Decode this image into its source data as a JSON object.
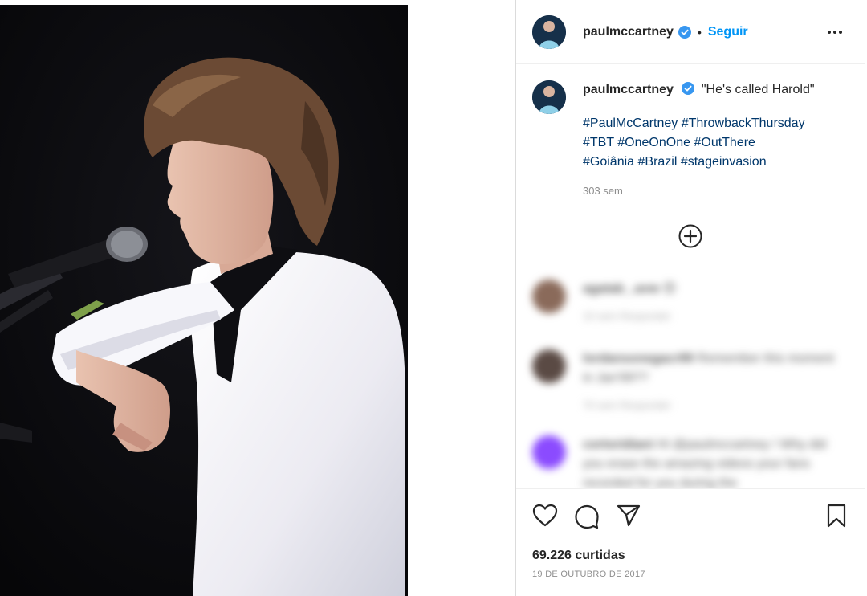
{
  "post": {
    "username": "paulmccartney",
    "follow_label": "Seguir",
    "separator": "•",
    "caption": "\"He's called Harold\"",
    "hashtags": [
      "#PaulMcCartney",
      "#ThrowbackThursday",
      "#TBT",
      "#OneOnOne",
      "#OutThere",
      "#Goiânia",
      "#Brazil",
      "#stageinvasion"
    ],
    "time_ago": "303 sem",
    "likes": "69.226 curtidas",
    "date": "19 DE OUTUBRO DE 2017"
  },
  "comments": [
    {
      "user": "agatab_.avw",
      "text": "😍",
      "meta": "10 sem    Responder",
      "avatar_color": "#8a6a5a"
    },
    {
      "user": "lordansonegacr99",
      "text": "Remember this moment in Jan'99??",
      "meta": "70 sem    Responder",
      "avatar_color": "#5a4a44"
    },
    {
      "user": "cortoridiani",
      "text": "Hi @paulmccartney ! Why did you erase the amazing videos your fans recorded for you during the",
      "meta": "",
      "avatar_color": "#8b4bff"
    }
  ],
  "icons": {
    "verified": "verified-badge-icon",
    "more": "more-options-icon",
    "load_more": "plus-circle-icon",
    "like": "heart-icon",
    "comment": "comment-icon",
    "share": "share-icon",
    "save": "bookmark-icon"
  },
  "colors": {
    "accent": "#0095f6",
    "hashtag": "#00376b",
    "verified": "#3897f0",
    "muted": "#8e8e8e"
  }
}
